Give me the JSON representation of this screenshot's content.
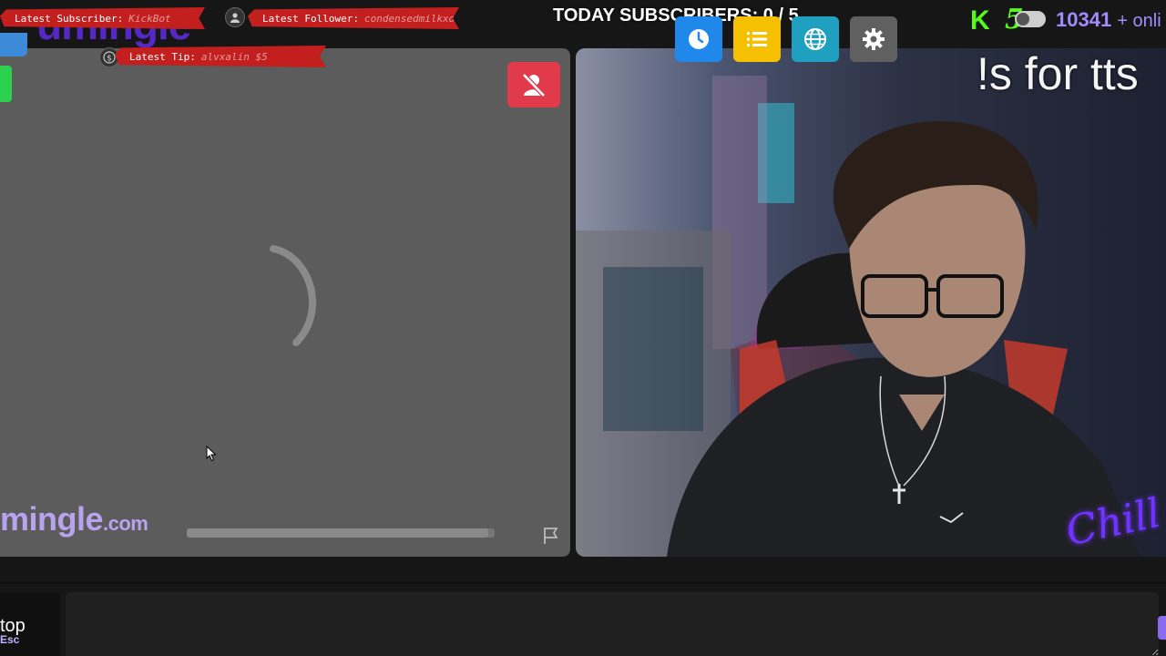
{
  "app": {
    "brand_name": "mingle",
    "brand_tld": ".com",
    "logo_watermark": "umingle"
  },
  "overlays": {
    "latest_subscriber_label": "Latest Subscriber:",
    "latest_subscriber_value": "KickBot",
    "latest_follower_label": "Latest Follower:",
    "latest_follower_value": "condensedmilkxo",
    "latest_tip_label": "Latest Tip:",
    "latest_tip_value": "alvxalin $5",
    "today_subscribers": "TODAY SUBSCRIBERS: 0 / 5",
    "tts_hint": "!s for tts",
    "chill_tag": "Chill"
  },
  "toolbar": {
    "history_icon": "clock-icon",
    "list_icon": "list-icon",
    "globe_icon": "globe-icon",
    "settings_icon": "gear-icon"
  },
  "status": {
    "kick_logo": "K",
    "kick_count": "5",
    "online_count": "10341",
    "online_suffix": "+ onli"
  },
  "left_pane": {
    "state": "connecting",
    "progress": 0.98
  },
  "bottom": {
    "stop_label": "top",
    "stop_key": "Esc",
    "chat_value": ""
  },
  "colors": {
    "mute_button": "#e03a4b",
    "kick_green": "#53fc18",
    "brand_purple": "#b9a3ef",
    "banner_red": "#c41f1f"
  }
}
